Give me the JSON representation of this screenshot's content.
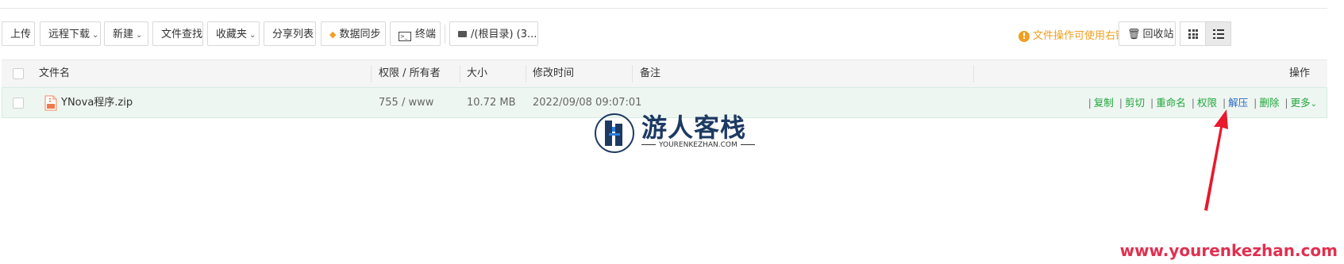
{
  "toolbar": {
    "upload": "上传",
    "remote_download": "远程下载",
    "new": "新建",
    "file_search": "文件查找",
    "favorites": "收藏夹",
    "share_list": "分享列表",
    "data_sync": "数据同步",
    "terminal": "终端",
    "path": "/(根目录) (3...",
    "hint": "文件操作可使用右键",
    "recycle_bin": "回收站"
  },
  "table": {
    "headers": {
      "name": "文件名",
      "perm_owner": "权限 / 所有者",
      "size": "大小",
      "mtime": "修改时间",
      "note": "备注",
      "ops": "操作"
    },
    "rows": [
      {
        "name": "YNova程序.zip",
        "perm_owner": "755 / www",
        "size": "10.72 MB",
        "mtime": "2022/09/08 09:07:01",
        "note": ""
      }
    ],
    "ops": {
      "copy": "复制",
      "cut": "剪切",
      "rename": "重命名",
      "perm": "权限",
      "unzip": "解压",
      "delete": "删除",
      "more": "更多"
    }
  },
  "logo": {
    "title": "游人客栈",
    "subtitle": "YOURENKEZHAN.COM"
  },
  "watermark": "www.yourenkezhan.com",
  "colors": {
    "accent_green": "#20a53a",
    "hint_orange": "#f0a020",
    "watermark_red": "#e03050",
    "arrow_red": "#e8192c",
    "logo_navy": "#1d3a62"
  }
}
